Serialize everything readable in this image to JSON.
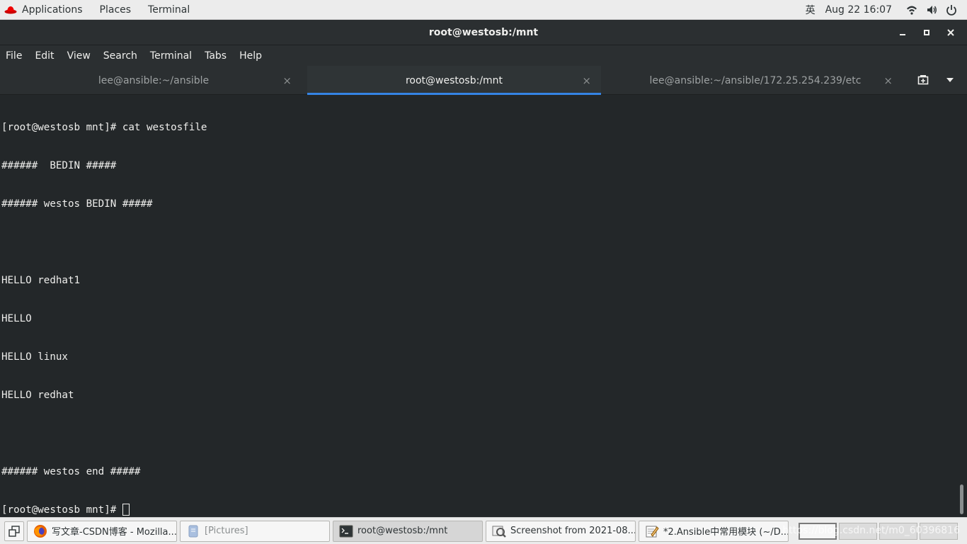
{
  "top_panel": {
    "applications": "Applications",
    "places": "Places",
    "terminal": "Terminal",
    "input_method": "英",
    "clock": "Aug 22  16:07",
    "icons": [
      "wifi-icon",
      "volume-icon",
      "power-icon"
    ]
  },
  "window": {
    "title": "root@westosb:/mnt",
    "minimize": "–",
    "maximize": "▪",
    "close": "✕"
  },
  "menu": [
    "File",
    "Edit",
    "View",
    "Search",
    "Terminal",
    "Tabs",
    "Help"
  ],
  "tabs": [
    {
      "label": "lee@ansible:~/ansible",
      "close": "×"
    },
    {
      "label": "root@westosb:/mnt",
      "close": "×"
    },
    {
      "label": "lee@ansible:~/ansible/172.25.254.239/etc",
      "close": "×"
    }
  ],
  "terminal_lines": [
    "[root@westosb mnt]# cat westosfile",
    "######  BEDIN #####",
    "###### westos BEDIN #####",
    "",
    "HELLO redhat1",
    "HELLO",
    "HELLO linux",
    "HELLO redhat",
    "",
    "###### westos end #####",
    "[root@westosb mnt]# "
  ],
  "taskbar": {
    "tasks": [
      {
        "label": "写文章-CSDN博客 - Mozilla...",
        "icon": "firefox-icon"
      },
      {
        "label": "[Pictures]",
        "icon": "file-manager-icon"
      },
      {
        "label": "root@westosb:/mnt",
        "icon": "terminal-icon"
      },
      {
        "label": "Screenshot from 2021-08...",
        "icon": "image-viewer-icon"
      },
      {
        "label": "*2.Ansible中常用模块 (~/D...",
        "icon": "text-editor-icon"
      }
    ],
    "watermark": "https://blog.csdn.net/m0_60396816"
  },
  "colors": {
    "terminal_bg": "#232729",
    "terminal_fg": "#eeeeec",
    "tab_accent": "#3584e4",
    "panel_bg": "#ececec"
  }
}
